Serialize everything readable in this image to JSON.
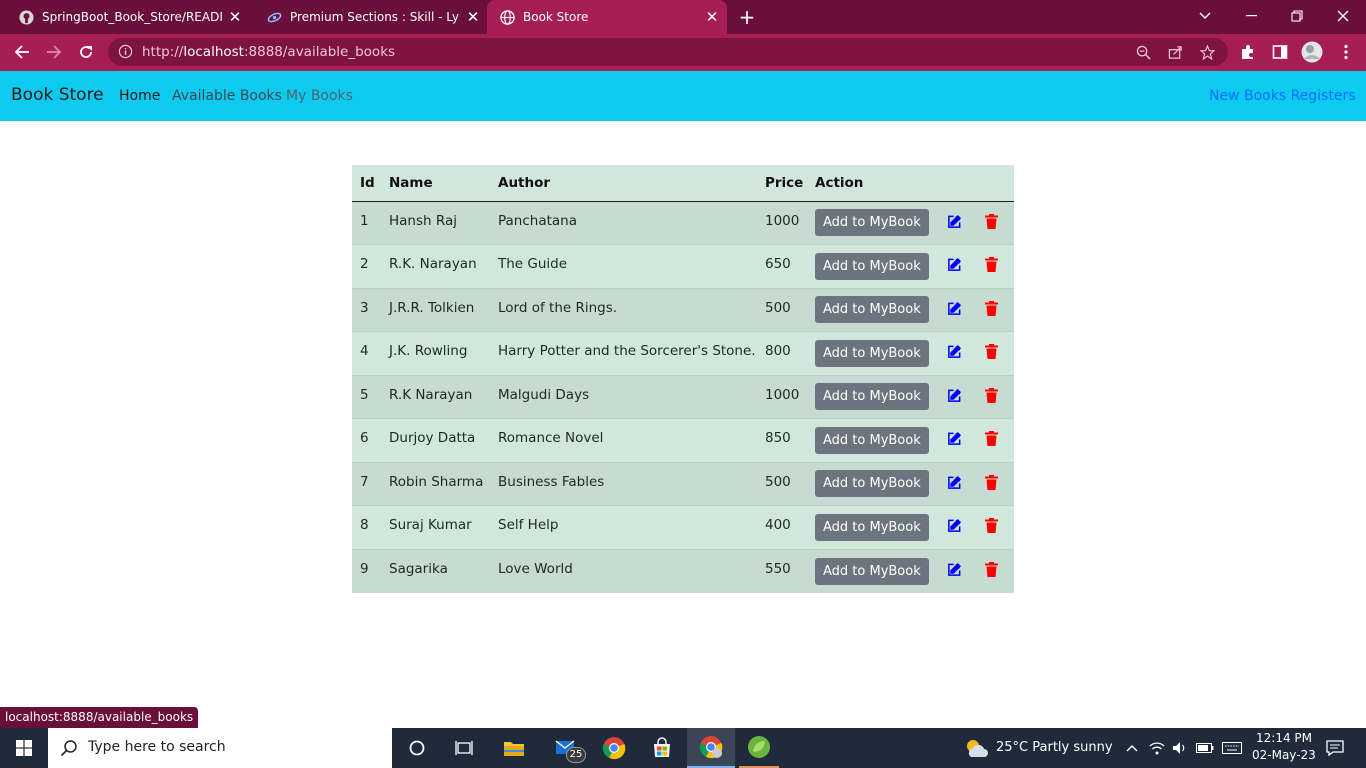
{
  "browser": {
    "tabs": [
      {
        "title": "SpringBoot_Book_Store/README",
        "icon": "github-icon",
        "active": false
      },
      {
        "title": "Premium Sections : Skill - Lync",
        "icon": "skill-lync-icon",
        "active": false
      },
      {
        "title": "Book Store",
        "icon": "globe-icon",
        "active": true
      }
    ],
    "new_tab": "+",
    "url_scheme": "http://",
    "url_host": "localhost",
    "url_rest": ":8888/available_books",
    "status_url": "localhost:8888/available_books",
    "colors": {
      "tabstrip": "#6a0f3a",
      "toolbar": "#a71d55"
    }
  },
  "app": {
    "brand": "Book Store",
    "nav": {
      "home": "Home",
      "available": "Available Books",
      "my_books": "My Books",
      "register": "New Books Registers"
    },
    "colors": {
      "navbar": "#0dcaf0",
      "table_header": "#d1e7dd",
      "button": "#6c757d",
      "edit": "#0000ff",
      "delete": "#ff0000"
    }
  },
  "table": {
    "headers": {
      "id": "Id",
      "name": "Name",
      "author": "Author",
      "price": "Price",
      "action": "Action"
    },
    "add_label": "Add to MyBook",
    "rows": [
      {
        "id": "1",
        "name": "Hansh Raj",
        "author": "Panchatana",
        "price": "1000"
      },
      {
        "id": "2",
        "name": "R.K. Narayan",
        "author": "The Guide",
        "price": "650"
      },
      {
        "id": "3",
        "name": "J.R.R. Tolkien",
        "author": "Lord of the Rings.",
        "price": "500"
      },
      {
        "id": "4",
        "name": "J.K. Rowling",
        "author": "Harry Potter and the Sorcerer's Stone.",
        "price": "800"
      },
      {
        "id": "5",
        "name": "R.K Narayan",
        "author": "Malgudi Days",
        "price": "1000"
      },
      {
        "id": "6",
        "name": "Durjoy Datta",
        "author": "Romance Novel",
        "price": "850"
      },
      {
        "id": "7",
        "name": "Robin Sharma",
        "author": "Business Fables",
        "price": "500"
      },
      {
        "id": "8",
        "name": "Suraj Kumar",
        "author": "Self Help",
        "price": "400"
      },
      {
        "id": "9",
        "name": "Sagarika",
        "author": "Love World",
        "price": "550"
      }
    ]
  },
  "taskbar": {
    "search_placeholder": "Type here to search",
    "mail_badge": "25",
    "weather": "25°C  Partly sunny",
    "time": "12:14 PM",
    "date": "02-May-23"
  }
}
